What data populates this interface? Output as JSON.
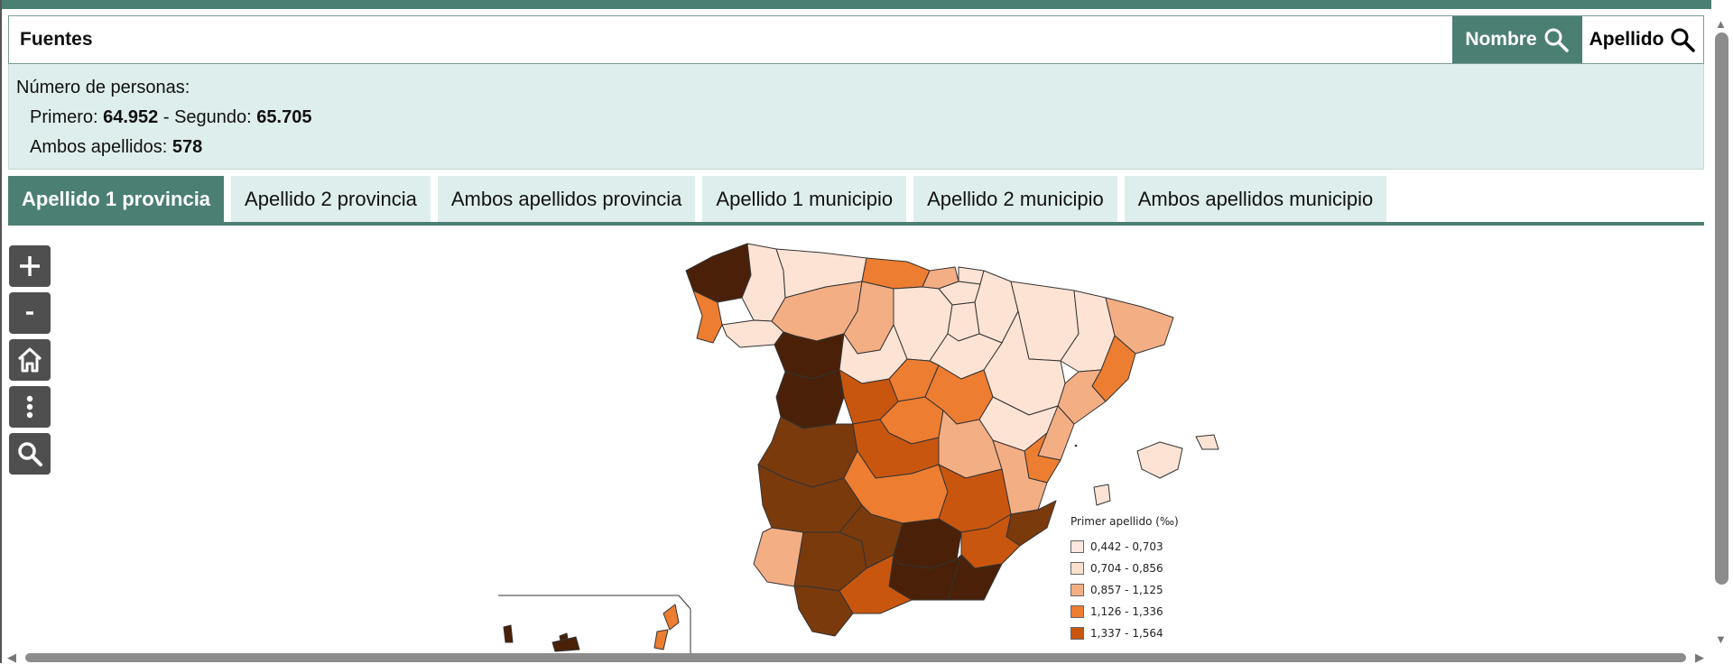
{
  "search": {
    "value": "Fuentes",
    "nombre_label": "Nombre",
    "apellido_label": "Apellido"
  },
  "info": {
    "heading": "Número de personas:",
    "primero_label": "Primero: ",
    "primero_value": "64.952",
    "segundo_label": " - Segundo: ",
    "segundo_value": "65.705",
    "ambos_label": "Ambos apellidos: ",
    "ambos_value": "578"
  },
  "tabs": [
    {
      "label": "Apellido 1 provincia",
      "active": true
    },
    {
      "label": "Apellido 2 provincia"
    },
    {
      "label": "Ambos apellidos provincia"
    },
    {
      "label": "Apellido 1 municipio"
    },
    {
      "label": "Apellido 2 municipio"
    },
    {
      "label": "Ambos apellidos municipio"
    }
  ],
  "tools": [
    "zoom-in-icon",
    "zoom-out-icon",
    "home-icon",
    "more-vertical-icon",
    "search-icon"
  ],
  "legend": {
    "title": "Primer apellido (‰)",
    "items": [
      {
        "label": "0,442 - 0,703",
        "color": "#fce8df"
      },
      {
        "label": "0,704 - 0,856",
        "color": "#fde0cc"
      },
      {
        "label": "0,857 - 1,125",
        "color": "#f4ae84"
      },
      {
        "label": "1,126 - 1,336",
        "color": "#ec7d31"
      },
      {
        "label": "1,337 - 1,564",
        "color": "#c9560f"
      }
    ]
  },
  "colors": {
    "accent": "#4b7f74",
    "panel": "#deeeec"
  }
}
